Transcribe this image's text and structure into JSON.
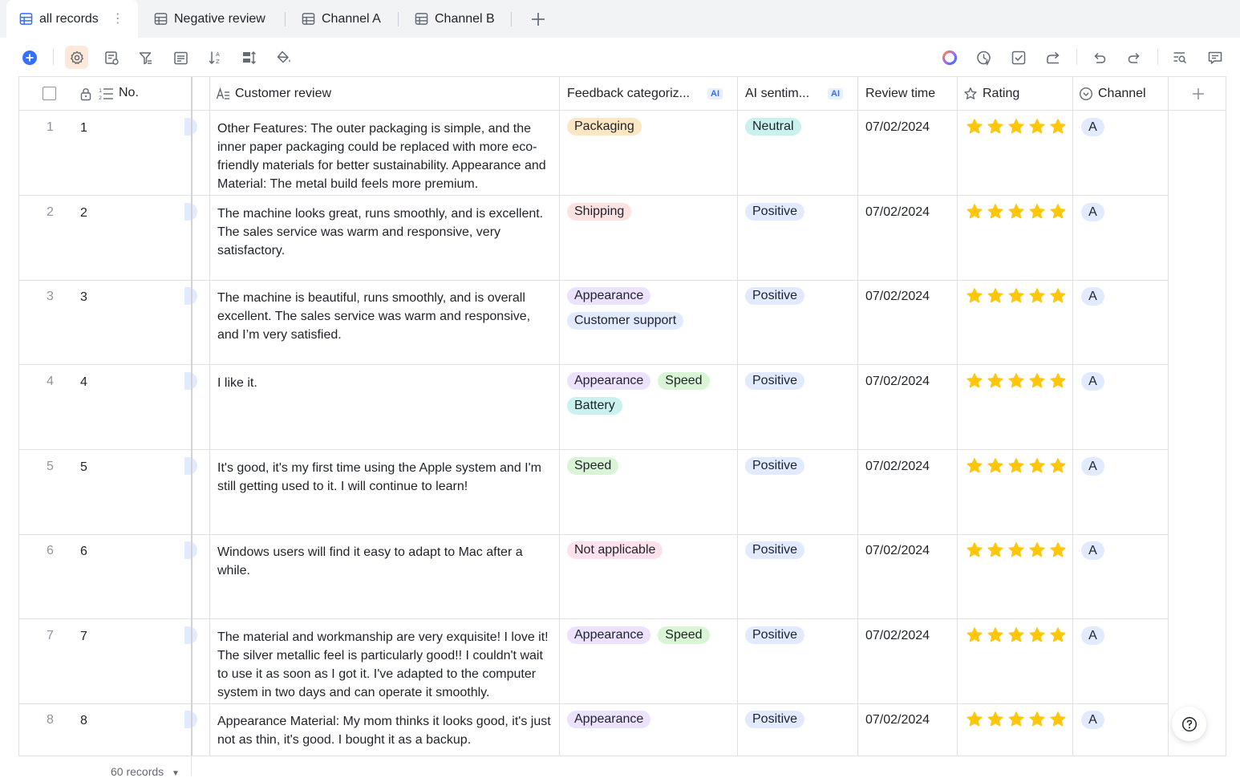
{
  "tabs": [
    {
      "label": "all records",
      "active": true
    },
    {
      "label": "Negative review",
      "active": false
    },
    {
      "label": "Channel A",
      "active": false
    },
    {
      "label": "Channel B",
      "active": false
    }
  ],
  "columns": {
    "no": "No.",
    "review": "Customer review",
    "category": "Feedback categoriz...",
    "sentiment": "AI sentim...",
    "time": "Review time",
    "rating": "Rating",
    "channel": "Channel",
    "ai_badge": "AI"
  },
  "tag_colors": {
    "Packaging": "#fbe7c3",
    "Shipping": "#fde2e2",
    "Appearance": "#ece2fe",
    "Customer support": "#e1eaff",
    "Speed": "#d9f5d6",
    "Battery": "#c9f1ee",
    "Not applicable": "#fde2ee",
    "Neutral": "#c9f1ee",
    "Positive": "#e1eaff"
  },
  "star_color": "#ffc60a",
  "rows": [
    {
      "index": "1",
      "no": "1",
      "review": "Other Features: The outer packaging is simple, and the inner paper packaging could be replaced with more eco-friendly materials for better sustainability. Appearance and Material: The metal build feels more premium.",
      "categories": [
        "Packaging"
      ],
      "sentiment": "Neutral",
      "time": "07/02/2024",
      "rating": 5,
      "channel": "A"
    },
    {
      "index": "2",
      "no": "2",
      "review": "The machine looks great, runs smoothly, and is excellent. The sales service was warm and responsive, very satisfactory.",
      "categories": [
        "Shipping"
      ],
      "sentiment": "Positive",
      "time": "07/02/2024",
      "rating": 5,
      "channel": "A"
    },
    {
      "index": "3",
      "no": "3",
      "review": "The machine is beautiful, runs smoothly, and is overall excellent. The sales service was warm and responsive, and I’m very satisfied.",
      "categories": [
        "Appearance",
        "Customer support"
      ],
      "sentiment": "Positive",
      "time": "07/02/2024",
      "rating": 5,
      "channel": "A"
    },
    {
      "index": "4",
      "no": "4",
      "review": "I like it.",
      "categories": [
        "Appearance",
        "Speed",
        "Battery"
      ],
      "sentiment": "Positive",
      "time": "07/02/2024",
      "rating": 5,
      "channel": "A"
    },
    {
      "index": "5",
      "no": "5",
      "review": "It's good, it's my first time using the Apple system and I'm still getting used to it. I will continue to learn!",
      "categories": [
        "Speed"
      ],
      "sentiment": "Positive",
      "time": "07/02/2024",
      "rating": 5,
      "channel": "A"
    },
    {
      "index": "6",
      "no": "6",
      "review": "Windows users will find it easy to adapt to Mac after a while.",
      "categories": [
        "Not applicable"
      ],
      "sentiment": "Positive",
      "time": "07/02/2024",
      "rating": 5,
      "channel": "A"
    },
    {
      "index": "7",
      "no": "7",
      "review": "The material and workmanship are very exquisite! I love it! The silver metallic feel is particularly good!! I couldn't wait to use it as soon as I got it. I've adapted to the computer system in two days and can operate it smoothly.",
      "categories": [
        "Appearance",
        "Speed"
      ],
      "sentiment": "Positive",
      "time": "07/02/2024",
      "rating": 5,
      "channel": "A"
    },
    {
      "index": "8",
      "no": "8",
      "review": "Appearance Material: My mom thinks it looks good, it's just not as thin, it's good. I bought it as a backup.",
      "categories": [
        "Appearance"
      ],
      "sentiment": "Positive",
      "time": "07/02/2024",
      "rating": 5,
      "channel": "A"
    }
  ],
  "footer": {
    "records": "60 records"
  }
}
